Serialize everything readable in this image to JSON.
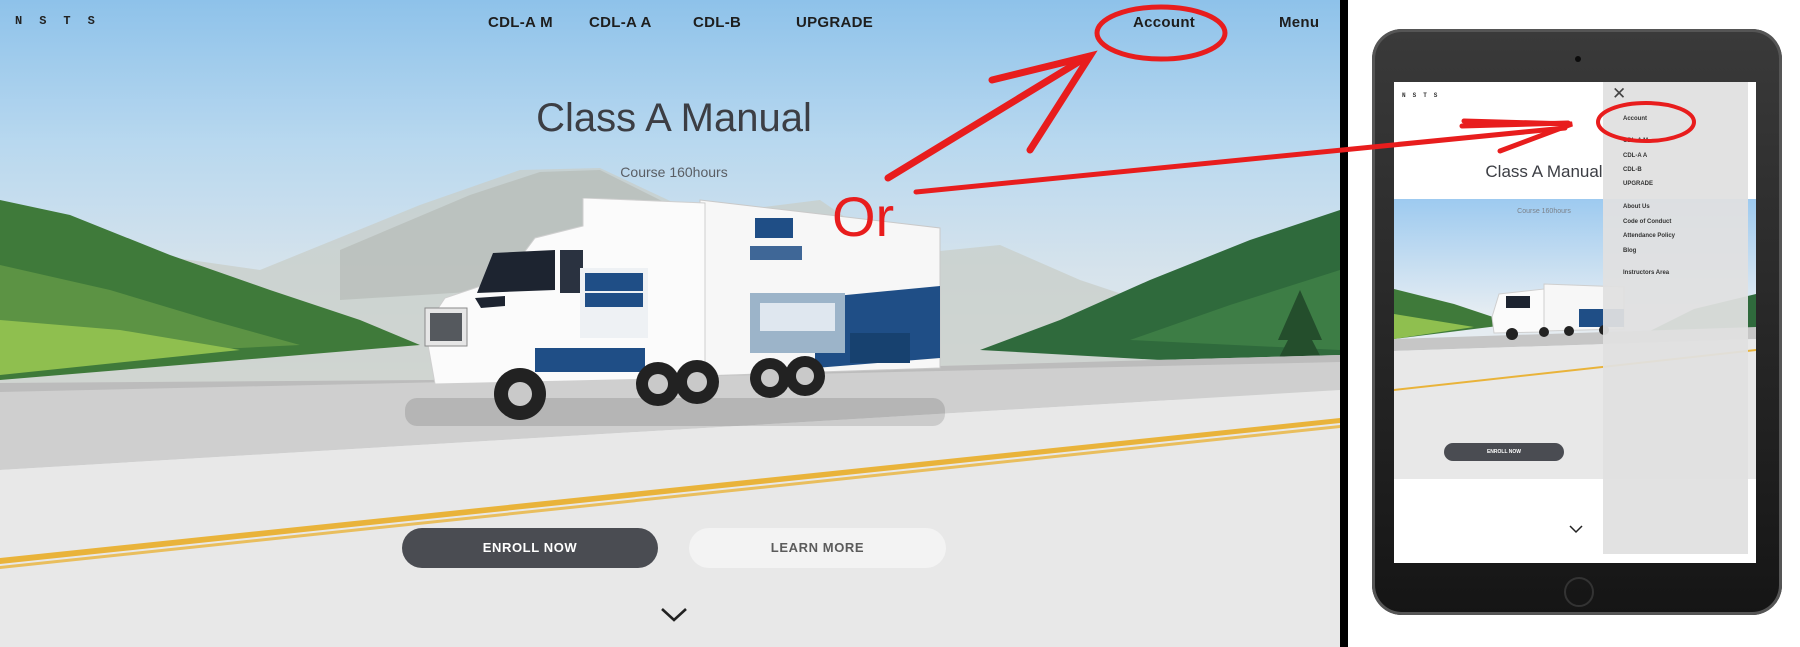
{
  "desktop": {
    "logo": "NSTS",
    "nav": {
      "links": [
        "CDL-A M",
        "CDL-A A",
        "CDL-B",
        "UPGRADE"
      ],
      "account": "Account",
      "menu": "Menu"
    },
    "hero": {
      "title": "Class A Manual",
      "subtitle": "Course 160hours",
      "enroll_button": "ENROLL NOW",
      "learn_button": "LEARN MORE",
      "scroll_icon": "chevron-down-icon"
    }
  },
  "annotation": {
    "or_label": "Or",
    "color": "#e81d1d"
  },
  "tablet": {
    "logo": "NSTS",
    "hero": {
      "title": "Class A Manual",
      "subtitle": "Course 160hours",
      "enroll_button": "ENROLL NOW"
    },
    "drawer": {
      "close_icon": "close-icon",
      "items": [
        "Account",
        "CDL-A M",
        "CDL-A A",
        "CDL-B",
        "UPGRADE",
        "About Us",
        "Code of Conduct",
        "Attendance Policy",
        "Blog",
        "Instructors Area"
      ]
    }
  }
}
